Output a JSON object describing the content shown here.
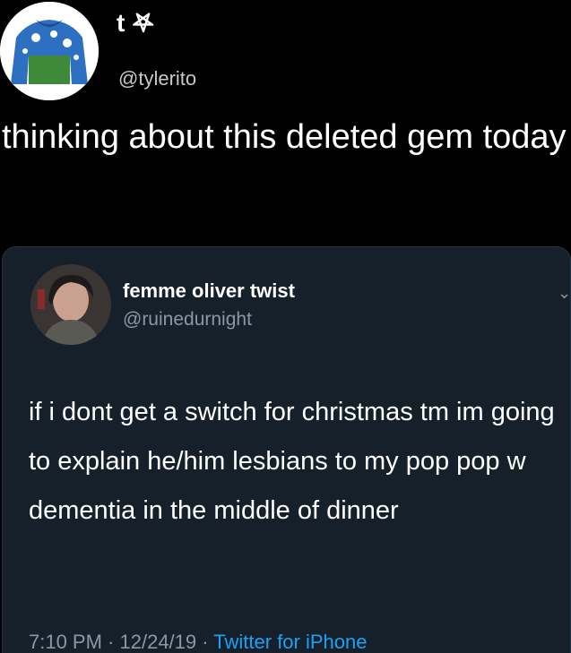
{
  "tweet": {
    "display_name": "t 𖤐",
    "handle": "@tylerito",
    "text": "thinking about this deleted gem today",
    "avatar": "sweater-avatar-icon"
  },
  "quoted_tweet": {
    "display_name": "femme oliver twist",
    "handle": "@ruinedurnight",
    "text": "if i dont get a switch for christmas tm im going to explain he/him lesbians to my pop pop w dementia in the middle of dinner",
    "time": "7:10 PM",
    "separator1": " · ",
    "date": "12/24/19",
    "separator2": " · ",
    "source": "Twitter for iPhone",
    "avatar": "profile-photo-icon",
    "chevron": "chevron-down-icon"
  },
  "colors": {
    "background": "#000000",
    "card": "#15202b",
    "muted": "#8899a6",
    "link": "#1da1f2"
  }
}
